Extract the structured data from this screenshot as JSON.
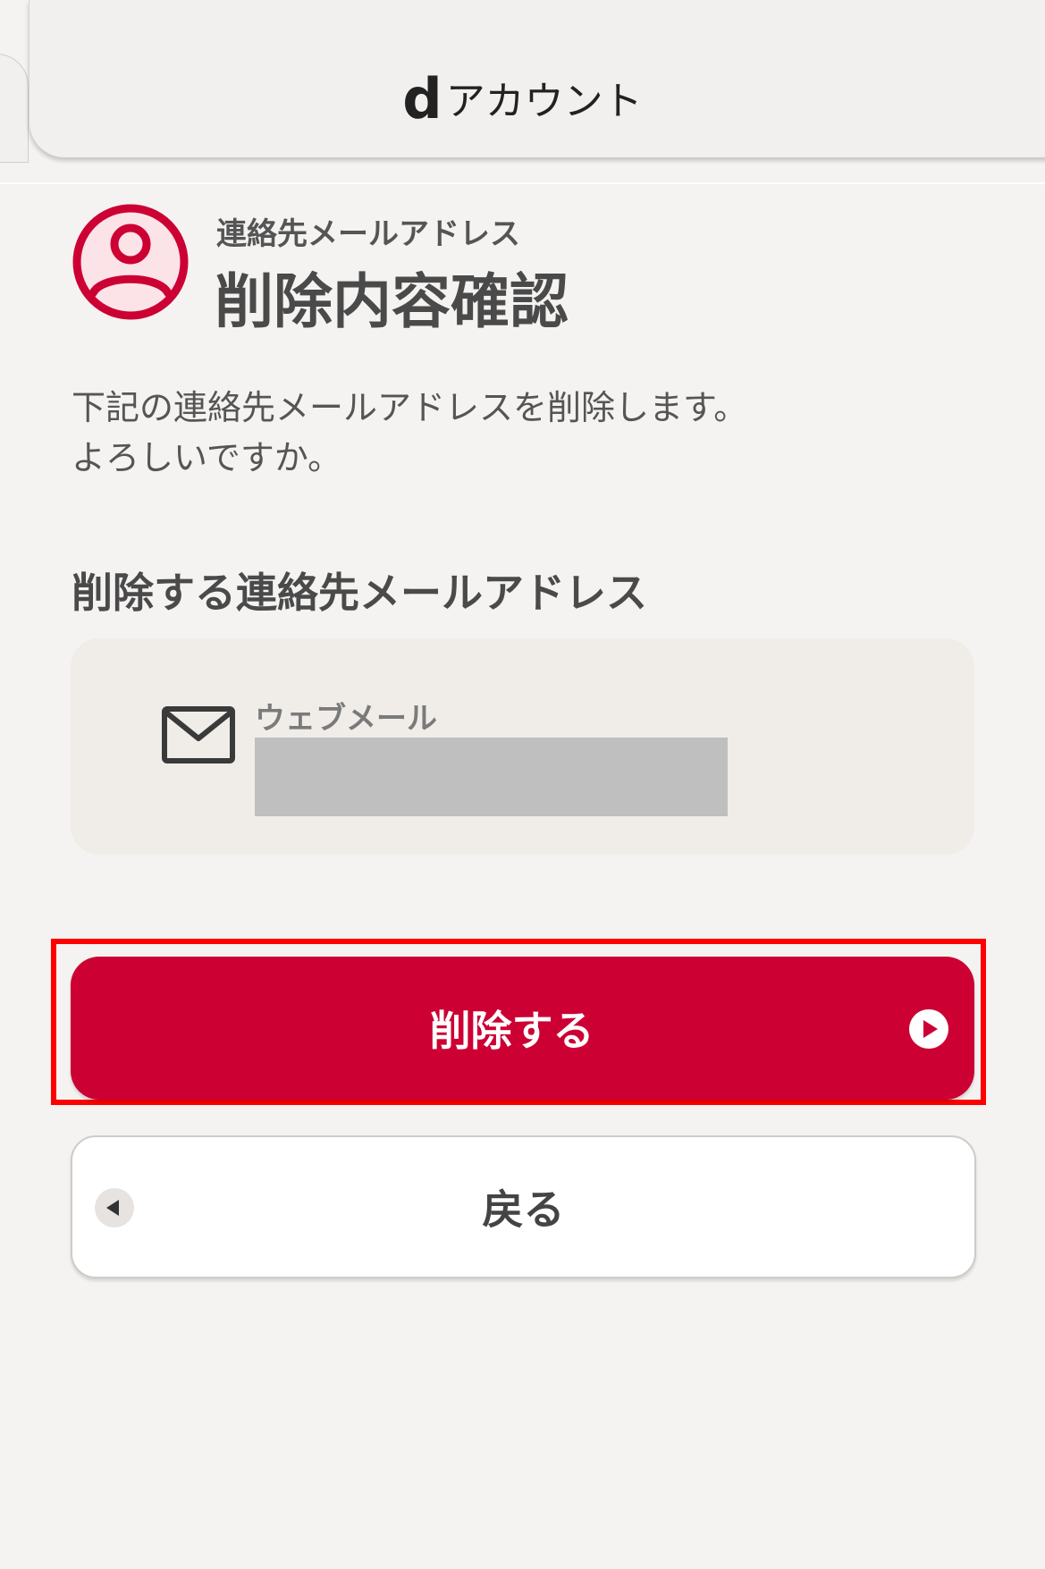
{
  "header": {
    "brand_mark": "d",
    "brand_name": "アカウント"
  },
  "title": {
    "sub": "連絡先メールアドレス",
    "main": "削除内容確認",
    "icon": "user-circle-icon"
  },
  "description": {
    "line1": "下記の連絡先メールアドレスを削除します。",
    "line2": "よろしいですか。"
  },
  "section": {
    "heading": "削除する連絡先メールアドレス"
  },
  "mail_card": {
    "icon": "mail-icon",
    "label": "ウェブメール"
  },
  "buttons": {
    "delete_label": "削除する",
    "back_label": "戻る"
  },
  "colors": {
    "primary": "#cc0033",
    "highlight": "#ff0000",
    "background": "#f4f3f1",
    "card": "#f0ede9"
  }
}
